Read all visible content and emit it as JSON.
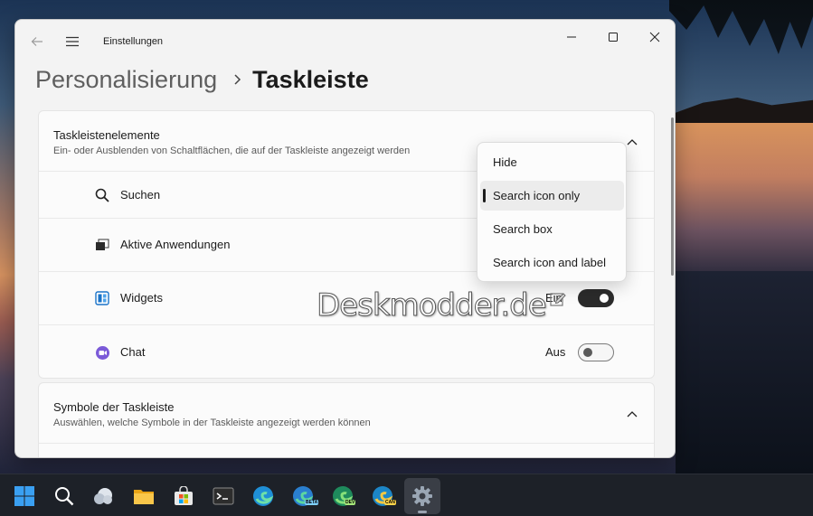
{
  "window": {
    "app_title": "Einstellungen",
    "breadcrumb": {
      "parent": "Personalisierung",
      "separator": "›",
      "current": "Taskleiste"
    }
  },
  "card_taskbar_items": {
    "title": "Taskleistenelemente",
    "subtitle": "Ein- oder Ausblenden von Schaltflächen, die auf der Taskleiste angezeigt werden",
    "rows": [
      {
        "label": "Suchen",
        "icon": "search-icon"
      },
      {
        "label": "Aktive Anwendungen",
        "icon": "task-view-icon"
      },
      {
        "label": "Widgets",
        "icon": "widgets-icon",
        "state": "Ein",
        "toggle_on": true
      },
      {
        "label": "Chat",
        "icon": "chat-icon",
        "state": "Aus",
        "toggle_on": false
      }
    ]
  },
  "card_taskbar_icons": {
    "title": "Symbole der Taskleiste",
    "subtitle": "Auswählen, welche Symbole in der Taskleiste angezeigt werden können"
  },
  "search_dropdown": {
    "options": [
      "Hide",
      "Search icon only",
      "Search box",
      "Search icon and label"
    ],
    "selected": "Search icon only"
  },
  "watermark": "Deskmodder.de",
  "taskbar": {
    "items": [
      "start-icon",
      "search-icon",
      "widgets-weather-icon",
      "file-explorer-icon",
      "microsoft-store-icon",
      "terminal-icon",
      "edge-icon",
      "edge-beta-icon",
      "edge-dev-icon",
      "edge-canary-icon",
      "settings-icon"
    ],
    "badges": {
      "edge_beta": "BETA",
      "edge_dev": "DEV",
      "edge_canary": "CAN"
    },
    "active": "settings-icon"
  },
  "colors": {
    "accent": "#2b2b2b",
    "window_bg": "#f3f3f3",
    "card_bg": "#fbfbfb",
    "taskbar_bg": "#1d2128"
  }
}
